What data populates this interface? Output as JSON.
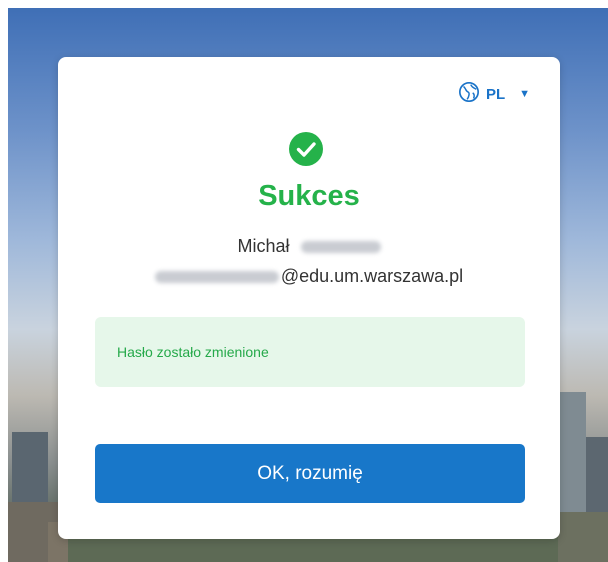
{
  "language": {
    "code": "PL",
    "icon": "globe-icon",
    "caret": "▼"
  },
  "status": {
    "icon": "check-circle-icon",
    "title": "Sukces",
    "color": "#25b24a"
  },
  "user": {
    "first_name": "Michał",
    "email_domain": "@edu.um.warszawa.pl"
  },
  "message": "Hasło zostało zmienione",
  "ok_button": {
    "label": "OK, rozumię",
    "color": "#1877c9"
  }
}
